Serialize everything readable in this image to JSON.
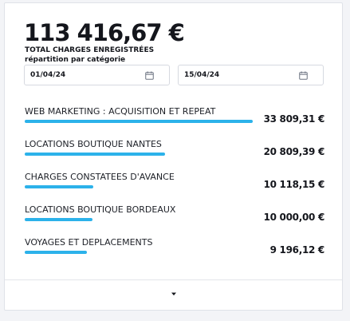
{
  "summary": {
    "total": "113 416,67 €",
    "total_label": "TOTAL CHARGES ENREGISTRÉES",
    "breakdown_label": "répartition par catégorie"
  },
  "filters": {
    "start_date": "01/04/24",
    "end_date": "15/04/24",
    "date_icon": "calendar-icon"
  },
  "categories": [
    {
      "label": "WEB MARKETING : ACQUISITION ET REPEAT",
      "value": "33 809,31 €",
      "amount": 33809.31
    },
    {
      "label": "LOCATIONS BOUTIQUE NANTES",
      "value": "20 809,39 €",
      "amount": 20809.39
    },
    {
      "label": "CHARGES CONSTATEES D'AVANCE",
      "value": "10 118,15 €",
      "amount": 10118.15
    },
    {
      "label": "LOCATIONS BOUTIQUE BORDEAUX",
      "value": "10 000,00 €",
      "amount": 10000.0
    },
    {
      "label": "VOYAGES ET DEPLACEMENTS",
      "value": "9 196,12 €",
      "amount": 9196.12
    }
  ],
  "footer": {
    "expand_icon": "caret-down-icon"
  },
  "colors": {
    "bar": "#2cb2ea"
  }
}
